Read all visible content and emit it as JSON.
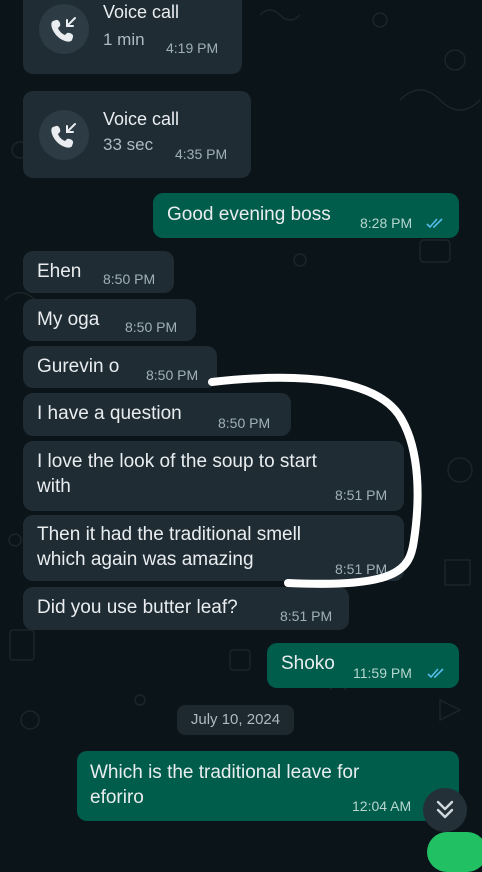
{
  "calls": [
    {
      "title": "Voice call",
      "duration": "1 min",
      "time": "4:19 PM"
    },
    {
      "title": "Voice call",
      "duration": "33 sec",
      "time": "4:35 PM"
    }
  ],
  "messages": [
    {
      "text": "Good evening boss",
      "time": "8:28 PM",
      "direction": "outgoing",
      "status": "read"
    },
    {
      "text": "Ehen",
      "time": "8:50 PM",
      "direction": "incoming"
    },
    {
      "text": "My oga",
      "time": "8:50 PM",
      "direction": "incoming"
    },
    {
      "text": "Gurevin o",
      "time": "8:50 PM",
      "direction": "incoming"
    },
    {
      "text": "I have a question",
      "time": "8:50 PM",
      "direction": "incoming"
    },
    {
      "line1": "I love the look of the soup to start",
      "line2": "with",
      "time": "8:51 PM",
      "direction": "incoming"
    },
    {
      "line1": "Then it had the traditional smell",
      "line2": "which again was amazing",
      "time": "8:51 PM",
      "direction": "incoming"
    },
    {
      "text": "Did you use butter leaf?",
      "time": "8:51 PM",
      "direction": "incoming"
    },
    {
      "text": "Shoko",
      "time": "11:59 PM",
      "direction": "outgoing",
      "status": "read"
    }
  ],
  "date_separator": "July 10, 2024",
  "last_message": {
    "line1": "Which is the traditional leave for",
    "line2": "eforiro",
    "time": "12:04 AM",
    "direction": "outgoing"
  },
  "colors": {
    "background": "#0b1418",
    "incoming_bubble": "#1f2c34",
    "outgoing_bubble": "#005c4b",
    "read_ticks": "#53bdeb",
    "annotation": "#ffffff"
  },
  "icons": {
    "call": "incoming-call-arrow-icon",
    "read_receipt": "double-check-icon",
    "scroll": "double-chevron-down-icon"
  },
  "annotation": "white hand-drawn bracket marking messages"
}
